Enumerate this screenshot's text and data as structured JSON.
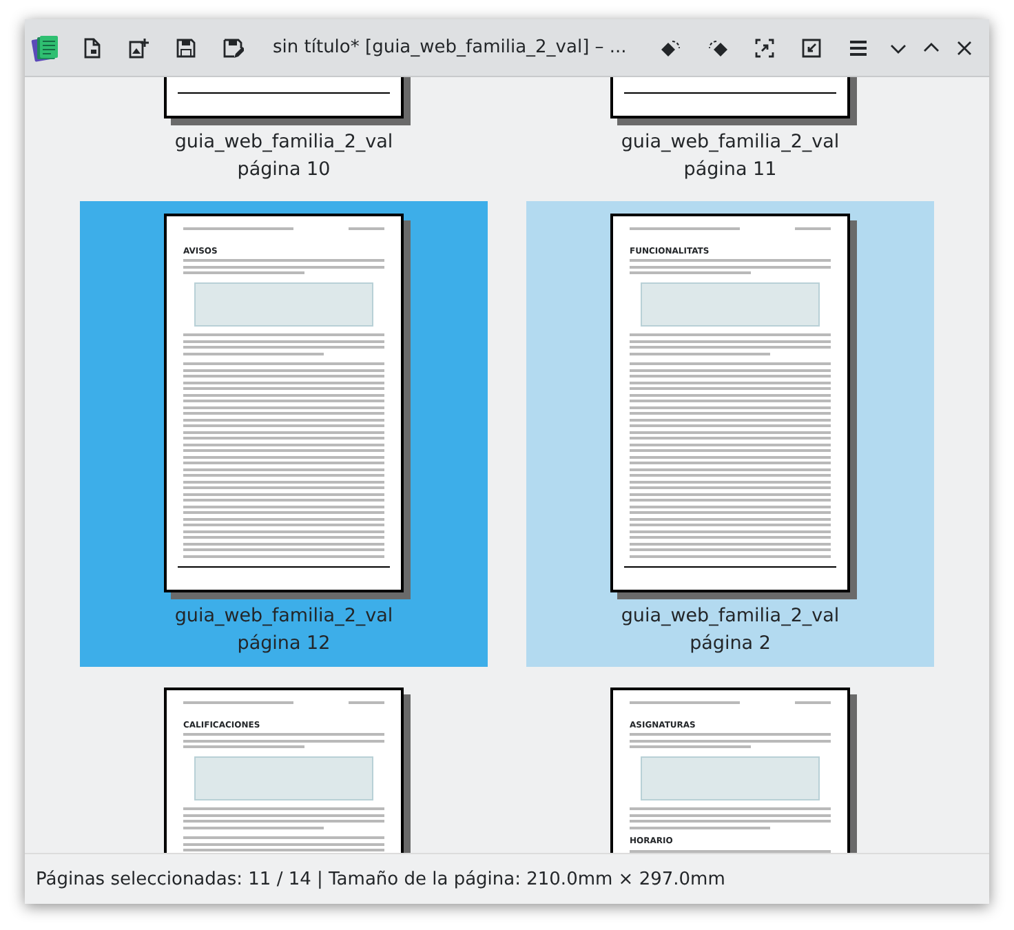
{
  "window": {
    "title": "sin título* [guia_web_familia_2_val] – ..."
  },
  "pages": [
    {
      "file": "guia_web_familia_2_val",
      "page": "página 10",
      "selected": false
    },
    {
      "file": "guia_web_familia_2_val",
      "page": "página 11",
      "selected": false
    },
    {
      "file": "guia_web_familia_2_val",
      "page": "página 12",
      "selected": true,
      "headings": [
        "AVISOS"
      ]
    },
    {
      "file": "guia_web_familia_2_val",
      "page": "página 2",
      "selected": false,
      "hovered": true,
      "headings": [
        "FUNCIONALITATS"
      ]
    },
    {
      "selected": false,
      "headings": [
        "CALIFICACIONES"
      ]
    },
    {
      "selected": false,
      "headings": [
        "ASIGNATURAS",
        "HORARIO"
      ]
    }
  ],
  "status_bar": "Páginas seleccionadas: 11 / 14 | Tamaño de la página: 210.0mm × 297.0mm"
}
